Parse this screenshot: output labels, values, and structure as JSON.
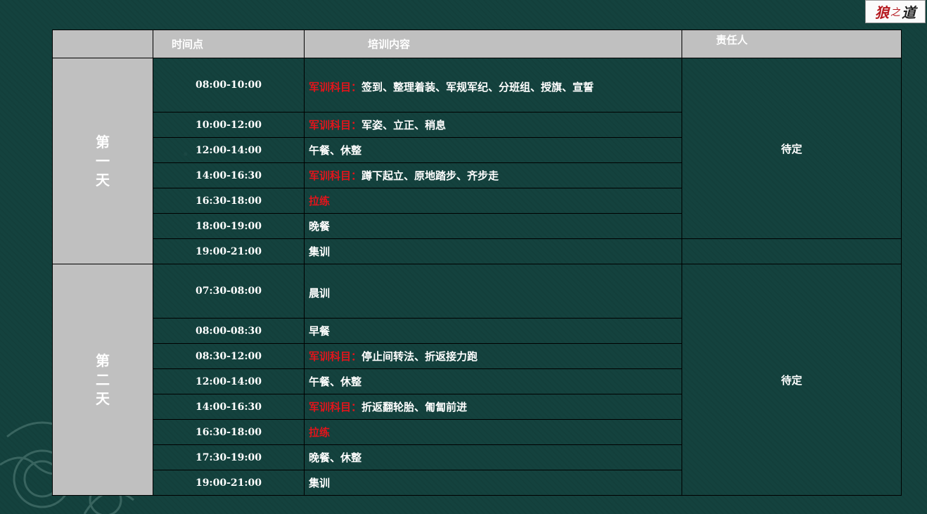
{
  "logo": {
    "char1": "狼",
    "char2": "之",
    "char3": "道"
  },
  "header": {
    "col_time": "时间点",
    "col_content": "培训内容",
    "col_owner": "责任人"
  },
  "days": [
    {
      "label_chars": [
        "第",
        "一",
        "天"
      ],
      "owner": "待定",
      "rows": [
        {
          "time": "08:00-10:00",
          "prefix": "军训科目：",
          "text": "签到、整理着装、军规军纪、分班组、授旗、宣誓"
        },
        {
          "time": "10:00-12:00",
          "prefix": "军训科目：",
          "text": "军姿、立正、稍息"
        },
        {
          "time": "12:00-14:00",
          "prefix": "",
          "text": "午餐、休整"
        },
        {
          "time": "14:00-16:30",
          "prefix": "军训科目：",
          "text": "蹲下起立、原地踏步、齐步走"
        },
        {
          "time": "16:30-18:00",
          "prefix": "拉练",
          "text": ""
        },
        {
          "time": "18:00-19:00",
          "prefix": "",
          "text": "晚餐"
        },
        {
          "time": "19:00-21:00",
          "prefix": "",
          "text": "集训"
        }
      ]
    },
    {
      "label_chars": [
        "第",
        "二",
        "天"
      ],
      "owner": "待定",
      "rows": [
        {
          "time": "07:30-08:00",
          "prefix": "",
          "text": "晨训"
        },
        {
          "time": "08:00-08:30",
          "prefix": "",
          "text": "早餐"
        },
        {
          "time": "08:30-12:00",
          "prefix": "军训科目：",
          "text": "停止间转法、折返接力跑"
        },
        {
          "time": "12:00-14:00",
          "prefix": "",
          "text": "午餐、休整"
        },
        {
          "time": "14:00-16:30",
          "prefix": "军训科目：",
          "text": "折返翻轮胎、匍匐前进"
        },
        {
          "time": "16:30-18:00",
          "prefix": "拉练",
          "text": ""
        },
        {
          "time": "17:30-19:00",
          "prefix": "",
          "text": "晚餐、休整"
        },
        {
          "time": "19:00-21:00",
          "prefix": "",
          "text": "集训"
        }
      ]
    }
  ]
}
